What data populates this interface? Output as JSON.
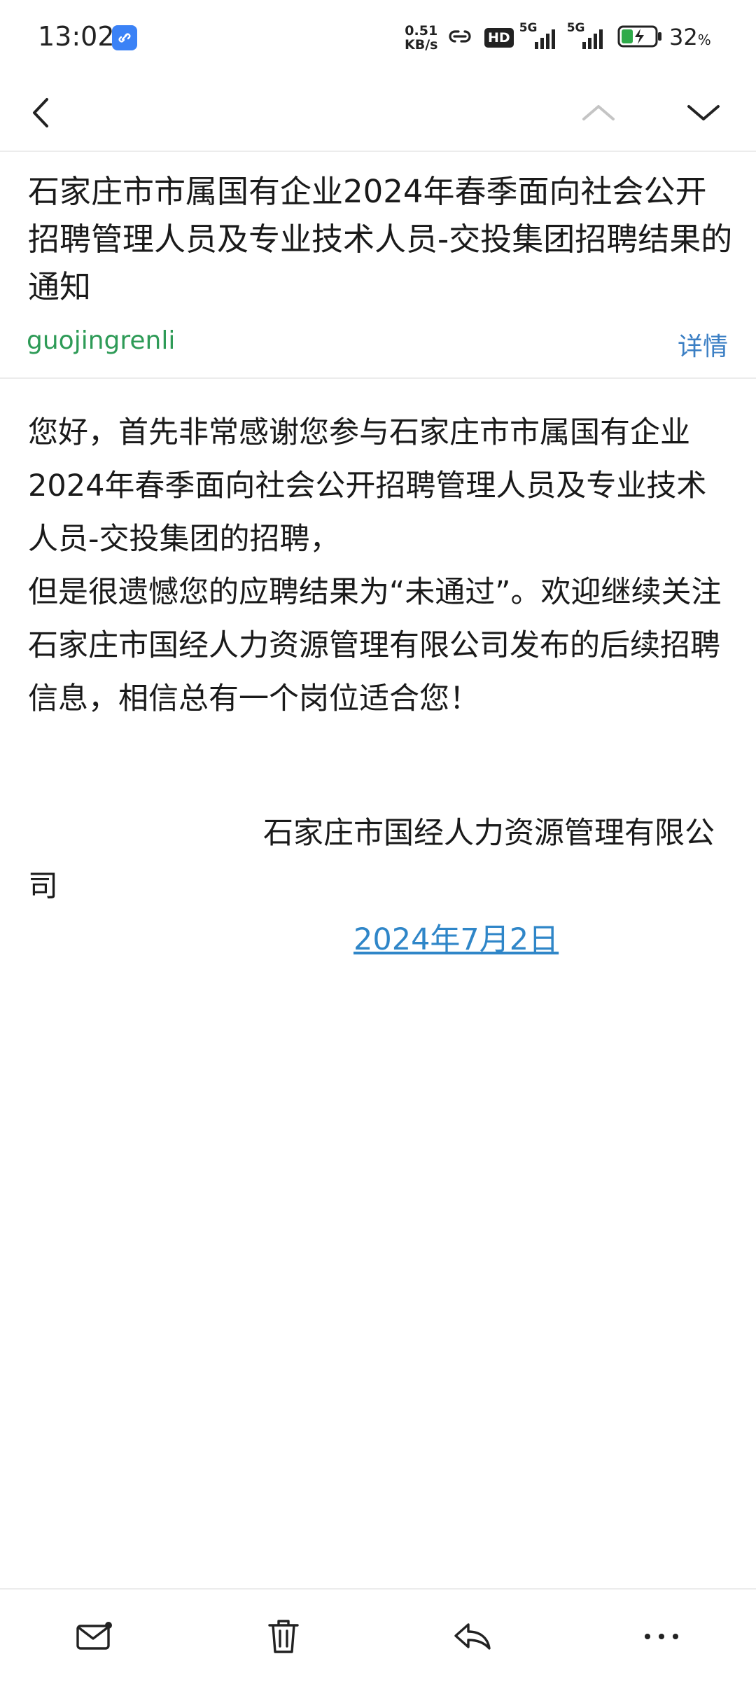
{
  "status_bar": {
    "time": "13:02",
    "net_speed_value": "0.51",
    "net_speed_unit": "KB/s",
    "hd_label": "HD",
    "network_1": "5G",
    "network_2": "5G",
    "battery_percent": "32",
    "battery_unit": "%",
    "icons": [
      "app-notification-icon",
      "link-icon",
      "hd-icon",
      "signal-icon",
      "signal-icon",
      "battery-charging-icon"
    ]
  },
  "nav": {
    "icons": [
      "back-arrow-icon",
      "previous-mail-icon",
      "next-mail-icon"
    ]
  },
  "mail": {
    "subject": "石家庄市市属国有企业2024年春季面向社会公开招聘管理人员及专业技术人员-交投集团招聘结果的通知",
    "sender": "guojingrenli",
    "details_label": "详情",
    "body_paragraph_1": "您好，首先非常感谢您参与石家庄市市属国有企业2024年春季面向社会公开招聘管理人员及专业技术人员-交投集团的招聘，",
    "body_paragraph_2": "但是很遗憾您的应聘结果为“未通过”。欢迎继续关注石家庄市国经人力资源管理有限公司发布的后续招聘信息，相信总有一个岗位适合您！",
    "signature": "石家庄市国经人力资源管理有限公司",
    "date": "2024年7月2日"
  },
  "toolbar": {
    "icons": [
      "mail-icon",
      "delete-icon",
      "reply-icon",
      "more-icon"
    ]
  },
  "colors": {
    "sender": "#2e9b57",
    "details": "#3b7fc4",
    "date_link": "#2f86c8",
    "notification_badge": "#3b82f6"
  }
}
